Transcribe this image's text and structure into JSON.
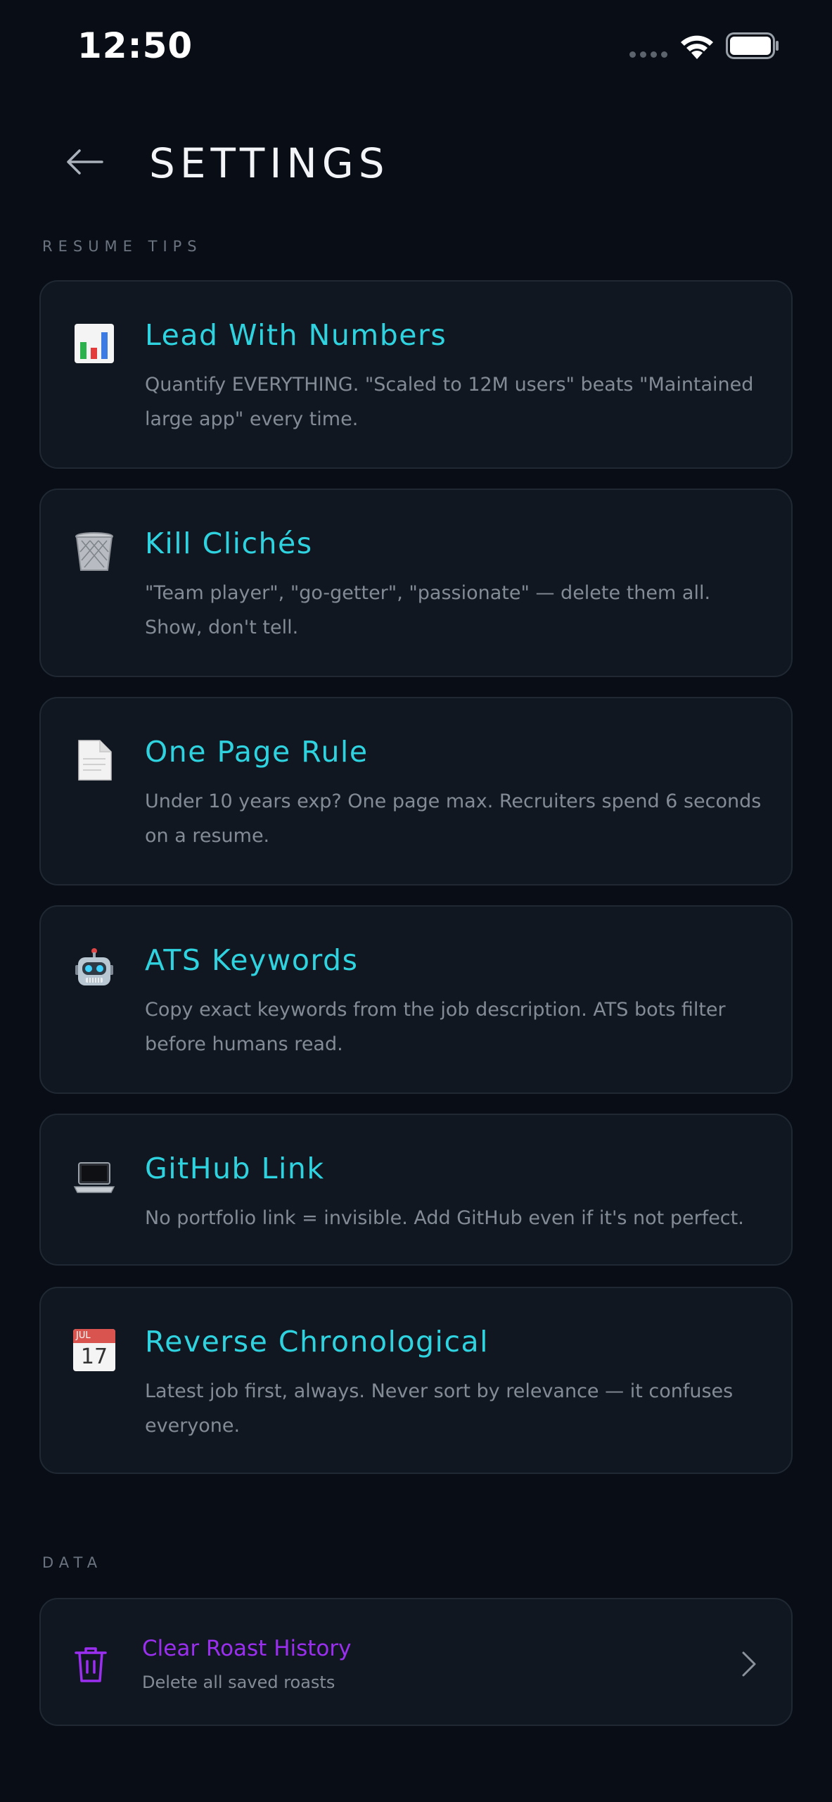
{
  "status_bar": {
    "time": "12:50"
  },
  "header": {
    "title": "SETTINGS",
    "back_icon": "arrow-left-icon"
  },
  "sections": {
    "resume_tips_label": "RESUME TIPS",
    "data_label": "DATA"
  },
  "tips": [
    {
      "icon": "bar-chart-emoji",
      "title": "Lead With Numbers",
      "description": "Quantify EVERYTHING. \"Scaled to 12M users\" beats \"Maintained large app\" every time."
    },
    {
      "icon": "wastebasket-emoji",
      "title": "Kill Clichés",
      "description": "\"Team player\", \"go-getter\", \"passionate\" — delete them all. Show, don't tell."
    },
    {
      "icon": "page-emoji",
      "title": "One Page Rule",
      "description": "Under 10 years exp? One page max. Recruiters spend 6 seconds on a resume."
    },
    {
      "icon": "robot-emoji",
      "title": "ATS Keywords",
      "description": "Copy exact keywords from the job description. ATS bots filter before humans read."
    },
    {
      "icon": "laptop-emoji",
      "title": "GitHub Link",
      "description": "No portfolio link = invisible. Add GitHub even if it's not perfect."
    },
    {
      "icon": "calendar-emoji",
      "title": "Reverse Chronological",
      "description": "Latest job first, always. Never sort by relevance — it confuses everyone.",
      "calendar_month": "JUL",
      "calendar_day": "17"
    }
  ],
  "data_actions": {
    "clear_history": {
      "title": "Clear Roast History",
      "subtitle": "Delete all saved roasts",
      "icon": "trash-icon"
    }
  },
  "colors": {
    "background": "#090d15",
    "card": "#111720",
    "accent_cyan": "#2fd3e0",
    "accent_purple": "#9b2ff0",
    "muted_text": "#838b96"
  }
}
